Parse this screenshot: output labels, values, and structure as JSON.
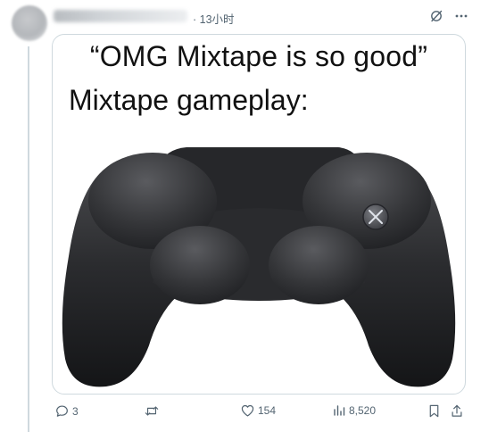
{
  "post": {
    "time": "· 13小时",
    "image_text": {
      "line1": "“OMG Mixtape is so good”",
      "line2": "Mixtape gameplay:"
    },
    "stats": {
      "replies": "3",
      "retweets": "",
      "likes": "154",
      "views": "8,520"
    }
  },
  "icons": {
    "grok": "grok-icon",
    "more": "more-icon",
    "reply": "reply-icon",
    "retweet": "retweet-icon",
    "like": "like-icon",
    "views": "views-icon",
    "bookmark": "bookmark-icon",
    "share": "share-icon"
  },
  "colors": {
    "muted_text": "#536471",
    "border": "#cfd9de"
  }
}
